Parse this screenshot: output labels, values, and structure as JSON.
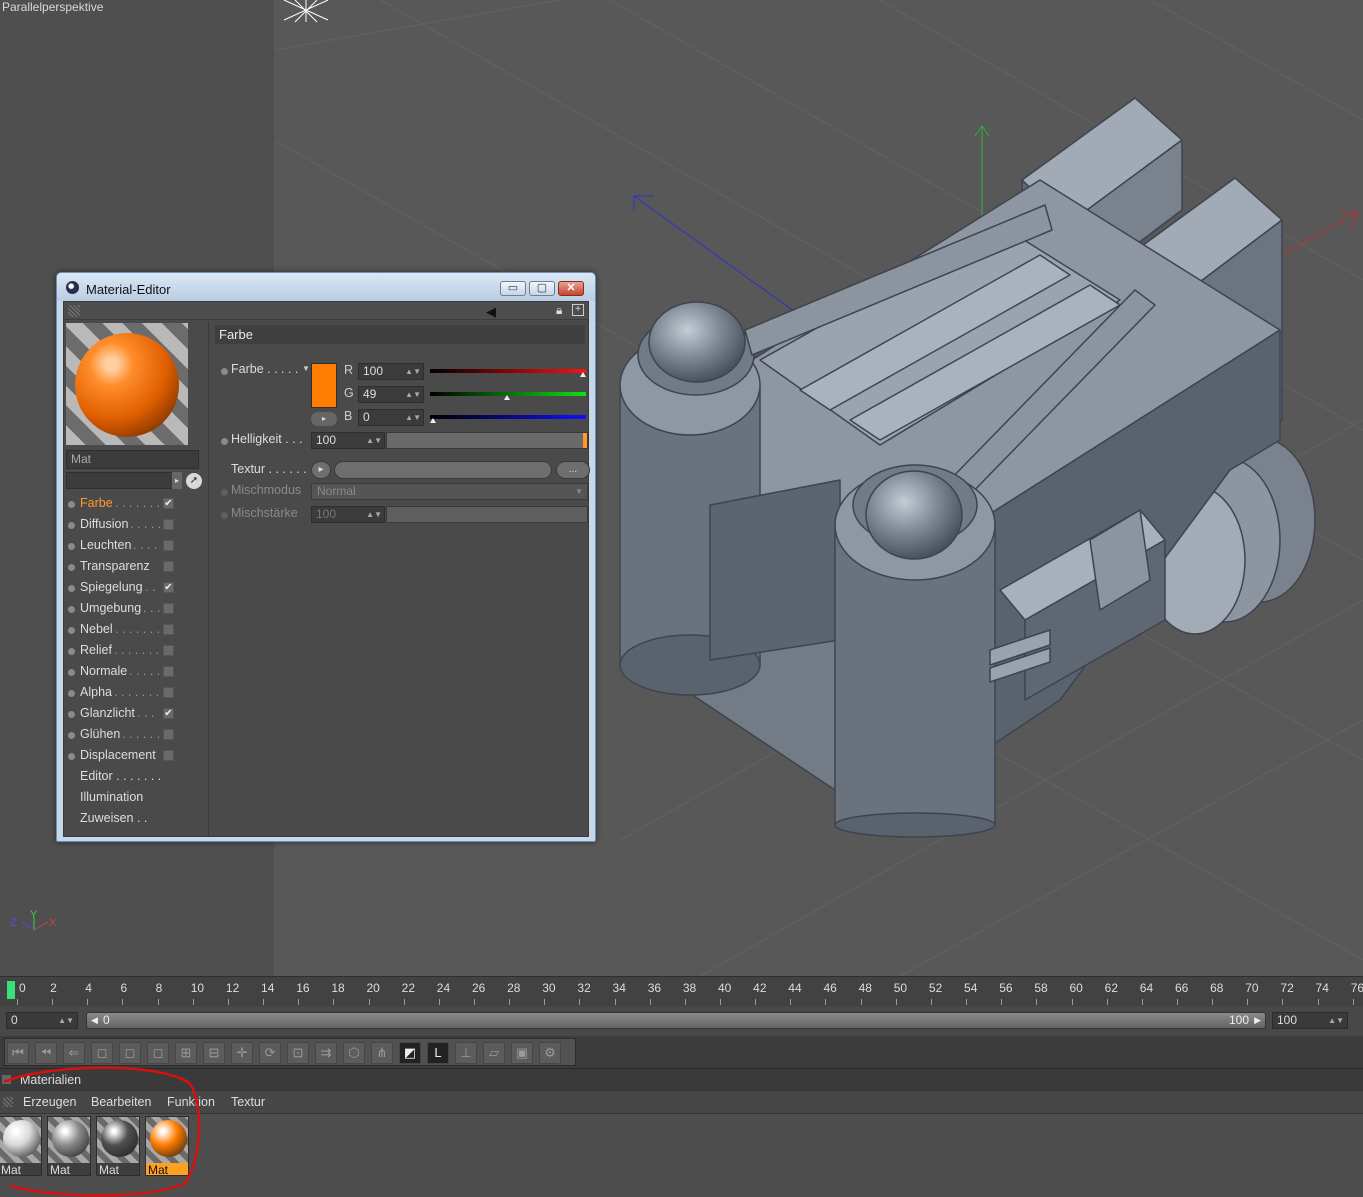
{
  "viewport": {
    "label": "Parallelperspektive"
  },
  "material_editor": {
    "title": "Material-Editor",
    "window_buttons": {
      "minimize": "▭",
      "maximize": "▢",
      "close": "✕"
    },
    "material_name": "Mat",
    "channels": [
      {
        "label": "Farbe",
        "dots": ". . . . . . . .",
        "checked": true,
        "active": true
      },
      {
        "label": "Diffusion",
        "dots": ". . . . .",
        "checked": false
      },
      {
        "label": "Leuchten",
        "dots": ". . . .",
        "checked": false
      },
      {
        "label": "Transparenz",
        "dots": "",
        "checked": false
      },
      {
        "label": "Spiegelung",
        "dots": ". .",
        "checked": true
      },
      {
        "label": "Umgebung",
        "dots": ". . .",
        "checked": false
      },
      {
        "label": "Nebel",
        "dots": ". . . . . . . .",
        "checked": false
      },
      {
        "label": "Relief",
        "dots": ". . . . . . . .",
        "checked": false
      },
      {
        "label": "Normale",
        "dots": ". . . . .",
        "checked": false
      },
      {
        "label": "Alpha",
        "dots": ". . . . . . . .",
        "checked": false
      },
      {
        "label": "Glanzlicht",
        "dots": ". . .",
        "checked": true
      },
      {
        "label": "Glühen",
        "dots": ". . . . . .",
        "checked": false
      },
      {
        "label": "Displacement",
        "dots": "",
        "checked": false
      }
    ],
    "extra_items": [
      {
        "label": "Editor . . . . . . ."
      },
      {
        "label": "Illumination"
      },
      {
        "label": "Zuweisen . ."
      }
    ],
    "section_title": "Farbe",
    "color": {
      "label": "Farbe . . . . .",
      "swatch": "#ff7d00",
      "r": {
        "letter": "R",
        "value": "100",
        "pos": 1.0
      },
      "g": {
        "letter": "G",
        "value": "49",
        "pos": 0.49
      },
      "b": {
        "letter": "B",
        "value": "0",
        "pos": 0.0
      }
    },
    "brightness": {
      "label": "Helligkeit . . .",
      "value": "100"
    },
    "texture": {
      "label": "Textur . . . . . .",
      "button": "..."
    },
    "blend_mode": {
      "label": "Mischmodus",
      "value": "Normal"
    },
    "blend_strength": {
      "label": "Mischstärke",
      "value": "100"
    }
  },
  "timeline": {
    "ticks": [
      "0",
      "2",
      "4",
      "6",
      "8",
      "10",
      "12",
      "14",
      "16",
      "18",
      "20",
      "22",
      "24",
      "26",
      "28",
      "30",
      "32",
      "34",
      "36",
      "38",
      "40",
      "42",
      "44",
      "46",
      "48",
      "50",
      "52",
      "54",
      "56",
      "58",
      "60",
      "62",
      "64",
      "66",
      "68",
      "70",
      "72",
      "74",
      "76"
    ],
    "range_start": "0",
    "slider_left": "0",
    "slider_right": "100",
    "range_end": "100"
  },
  "materials_manager": {
    "title": "Materialien",
    "menu": [
      "Erzeugen",
      "Bearbeiten",
      "Funktion",
      "Textur"
    ],
    "materials": [
      {
        "name": "Mat",
        "color": "#d8d8d8",
        "selected": false
      },
      {
        "name": "Mat",
        "color": "#8c8c8c",
        "selected": false
      },
      {
        "name": "Mat",
        "color": "#505050",
        "selected": false
      },
      {
        "name": "Mat",
        "color": "#ff7d00",
        "selected": true
      }
    ]
  },
  "colors": {
    "accent_orange": "#ff9a28",
    "annotation_red": "#d81010",
    "selection": "#ffa020"
  }
}
